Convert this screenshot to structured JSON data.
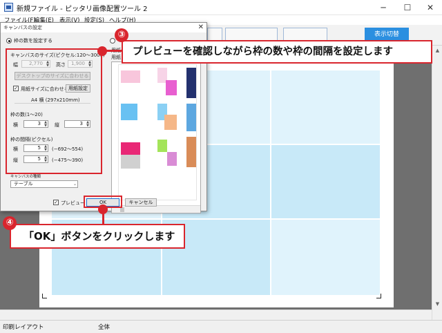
{
  "window": {
    "title": "新規ファイル - ピッタリ画像配置ツール 2",
    "controls": {
      "minimize": "─",
      "maximize": "☐",
      "close": "✕"
    }
  },
  "menubar": [
    "ファイル(F)",
    "編集(E)",
    "表示(V)",
    "設定(S)",
    "ヘルプ(H)"
  ],
  "toolbar": {
    "right_button": "表示切替"
  },
  "statusbar": {
    "left": "印刷レイアウト",
    "middle": "全体"
  },
  "dialog": {
    "title": "キャンバスの設定",
    "radio_count_label": "枠の数を設定する",
    "canvas_size_label": "キャンバスのサイズ(ピクセル:120〜3000)",
    "width_label": "幅",
    "width_value": "2,770",
    "height_label": "高さ",
    "height_value": "1,900",
    "desktop_size_button": "デスクトップのサイズに合わせる",
    "fit_paper_label": "用紙サイズに合わせる",
    "paper_settings_button": "用紙設定",
    "paper_info": "A4 横 (297x210mm)",
    "frame_count_label": "枠の数(1〜20)",
    "frame_h_label": "横",
    "frame_h_value": "3",
    "frame_v_label": "縦",
    "frame_v_value": "3",
    "gap_label": "枠の間隔(ピクセル)",
    "gap_h_label": "横",
    "gap_h_value": "5",
    "gap_h_range": "(−692〜554)",
    "gap_v_label": "縦",
    "gap_v_value": "5",
    "gap_v_range": "(−475〜390)",
    "canvas_kind_label": "キャンバスの種類",
    "canvas_kind_value": "テーブル",
    "paper_tab_1": "用紙",
    "paper_tab_2": "用紙",
    "preview_label": "プレビュー",
    "ok_button": "OK",
    "cancel_button": "キャンセル"
  },
  "annotations": {
    "step3_number": "③",
    "step3_text": "プレビューを確認しながら枠の数や枠の間隔を設定します",
    "step4_number": "④",
    "step4_text": "「OK」ボタンをクリックします",
    "accent_color": "#d9252d"
  }
}
